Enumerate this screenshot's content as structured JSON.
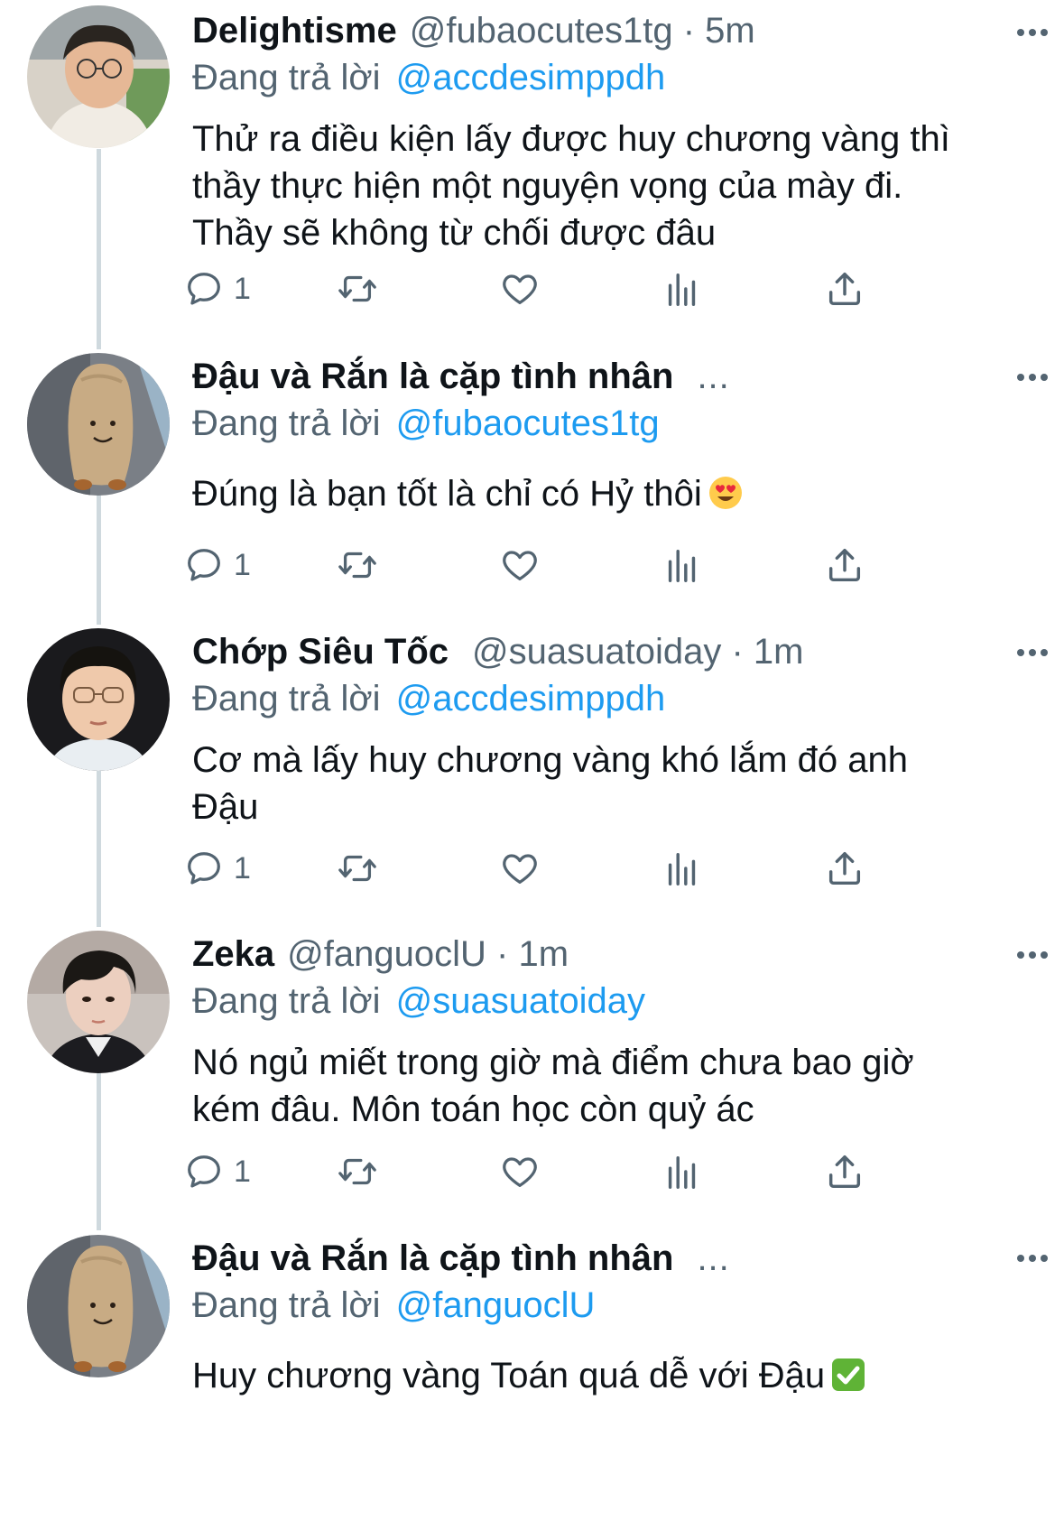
{
  "tweets": [
    {
      "name": "Delightisme",
      "meta": "@fubaocutes1tg · 5m",
      "reply_label": "Đang trả lời",
      "reply_handle": "@accdesimppdh",
      "lines": [
        "Thử ra điều kiện lấy được huy chương vàng thì",
        "thầy thực hiện một nguyện vọng của mày đi.",
        "Thầy sẽ không từ chối được đâu"
      ],
      "reply_count": "1"
    },
    {
      "name": "Đậu và Rắn là cặp tình nhân",
      "trunc": "...",
      "reply_label": "Đang trả lời",
      "reply_handle": "@fubaocutes1tg",
      "lines": [
        "Đúng là bạn tốt là chỉ có Hỷ thôi"
      ],
      "emoji": "heart-eyes-emoji",
      "reply_count": "1"
    },
    {
      "name": "Chớp Siêu Tốc",
      "meta": "@suasuatoiday · 1m",
      "reply_label": "Đang trả lời",
      "reply_handle": "@accdesimppdh",
      "lines": [
        "Cơ mà lấy huy chương vàng khó lắm đó anh",
        "Đậu"
      ],
      "reply_count": "1"
    },
    {
      "name": "Zeka",
      "meta": "@fanguoclU · 1m",
      "reply_label": "Đang trả lời",
      "reply_handle": "@suasuatoiday",
      "lines": [
        "Nó ngủ miết trong giờ mà điểm chưa bao giờ",
        "kém đâu. Môn toán học còn quỷ ác"
      ],
      "reply_count": "1"
    },
    {
      "name": "Đậu và Rắn là cặp tình nhân",
      "trunc": "...",
      "reply_label": "Đang trả lời",
      "reply_handle": "@fanguoclU",
      "lines": [
        "Huy chương vàng Toán quá dễ với Đậu"
      ],
      "emoji": "check-mark-emoji"
    }
  ],
  "colors": {
    "text": "#0f1419",
    "secondary": "#536471",
    "link": "#1d9bf0",
    "thread_line": "#cfd9de"
  }
}
